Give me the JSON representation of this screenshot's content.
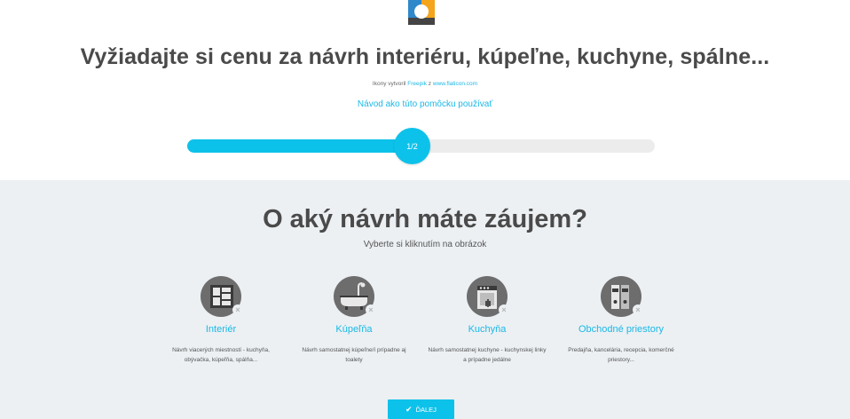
{
  "header": {
    "title": "Vyžiadajte si cenu za návrh interiéru, kúpeľne, kuchyne, spálne...",
    "credits_prefix": "Ikony vytvoril",
    "credits_author": "Freepik",
    "credits_mid": "z",
    "credits_site": "www.flaticon.com",
    "howto_link": "Návod ako túto pomôcku používať"
  },
  "progress": {
    "label": "1/2",
    "fraction": 0.5
  },
  "section": {
    "title": "O aký návrh máte záujem?",
    "subtitle": "Vyberte si kliknutím na obrázok"
  },
  "options": [
    {
      "name": "Interiér",
      "desc": "Návrh viacerých miestností - kuchyňa, obývačka, kúpeľňa, spálňa...",
      "icon": "floorplan-icon"
    },
    {
      "name": "Kúpeľňa",
      "desc": "Návrh samostatnej kúpeľne/í prípadne aj toalety",
      "icon": "bathtub-icon"
    },
    {
      "name": "Kuchyňa",
      "desc": "Návrh samostatnej kuchyne - kuchynskej linky a prípadne jedálne",
      "icon": "kitchen-icon"
    },
    {
      "name": "Obchodné priestory",
      "desc": "Predajňa, kancelária, recepcia, komerčné priestory...",
      "icon": "binders-icon"
    }
  ],
  "option_deselect_glyph": "×",
  "next_button": {
    "label": "ĎALEJ",
    "icon": "check-icon"
  },
  "colors": {
    "accent": "#0dc2ea",
    "link": "#1ab8e6",
    "section_bg": "#ecf0f3",
    "icon_disc": "#6d6d6d"
  }
}
